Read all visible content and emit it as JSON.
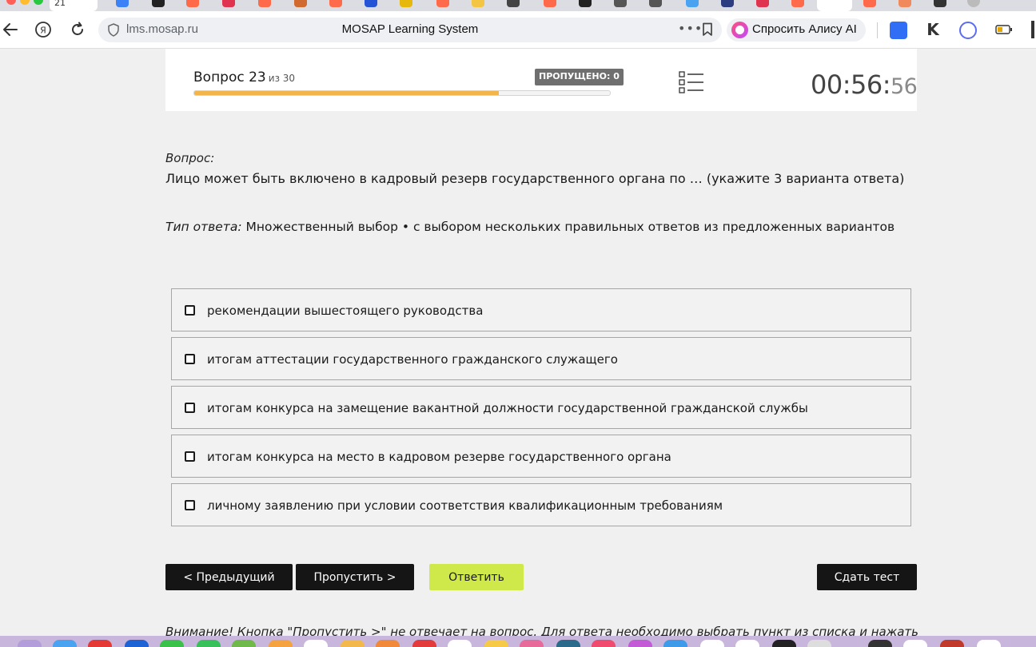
{
  "browser": {
    "active_tab_label": "21",
    "url": "lms.mosap.ru",
    "page_title": "MOSAP Learning System",
    "more_label": "•••",
    "alisa_label": "Спросить Алису AI",
    "icons": [
      "back-icon",
      "yandex-icon",
      "reload-icon",
      "shield-icon",
      "bookmark-icon",
      "list-icon"
    ]
  },
  "quiz": {
    "question_label": "Вопрос 23",
    "question_of": "из 30",
    "skipped_badge": "ПРОПУЩЕНО: 0",
    "progress_fraction": 0.733,
    "timer_main": "00:56:",
    "timer_seconds": "56"
  },
  "question": {
    "label": "Вопрос:",
    "text": "Лицо может быть включено в кадровый резерв государственного органа по … (укажите 3 варианта ответа)",
    "answer_type_label": "Тип ответа:",
    "answer_type": "Множественный выбор • с выбором нескольких правильных ответов из предложенных вариантов"
  },
  "options": [
    "рекомендации вышестоящего руководства",
    "итогам аттестации государственного гражданского служащего",
    "итогам конкурса на замещение вакантной должности государственной гражданской службы",
    "итогам конкурса на место в кадровом резерве государственного органа",
    "личному заявлению при условии соответствия квалификационным требованиям"
  ],
  "buttons": {
    "prev": "< Предыдущий",
    "skip": "Пропустить >",
    "answer": "Ответить",
    "submit": "Сдать тест"
  },
  "warning": "Внимание! Кнопка \"Пропустить >\" не отвечает на вопрос. Для ответа необходимо выбрать пункт из списка и нажать",
  "colors": {
    "progress": "#f2b54a",
    "answer_button": "#cfe84a",
    "dark_button": "#151515"
  }
}
